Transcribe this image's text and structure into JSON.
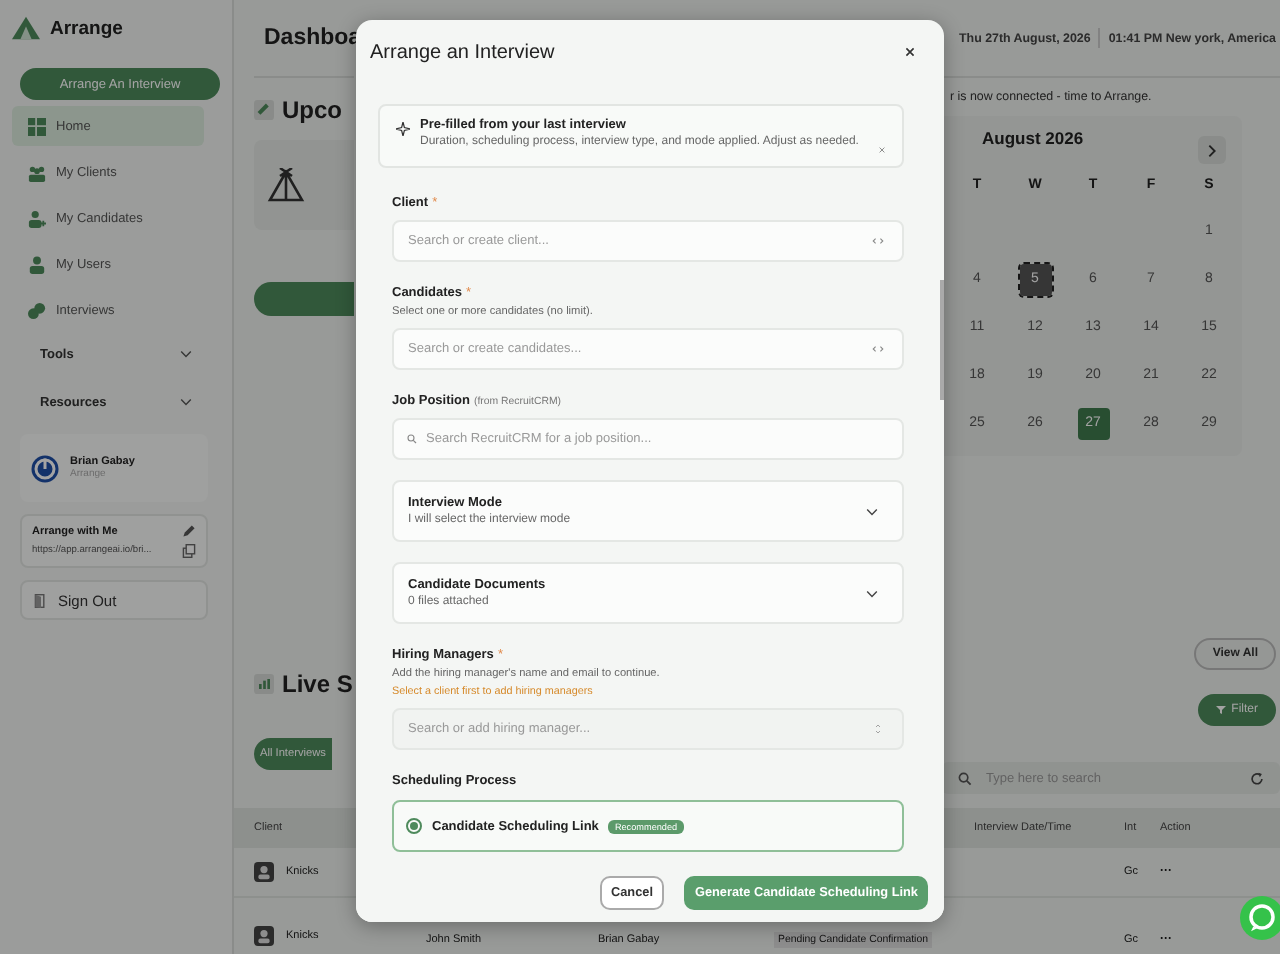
{
  "sidebar": {
    "brand": "Arrange",
    "cta": "Arrange An Interview",
    "items": [
      {
        "label": "Home",
        "selected": true
      },
      {
        "label": "My Clients",
        "selected": false
      },
      {
        "label": "My Candidates",
        "selected": false
      },
      {
        "label": "My Users",
        "selected": false
      },
      {
        "label": "Interviews",
        "selected": false
      }
    ],
    "sections": [
      {
        "label": "Tools",
        "expanded": false
      },
      {
        "label": "Resources",
        "expanded": false
      }
    ],
    "user": {
      "name": "Brian Gabay",
      "org": "Arrange"
    },
    "share": {
      "title": "Arrange with Me",
      "url": "https://app.arrangeai.io/bri..."
    },
    "sign_out": "Sign Out"
  },
  "header": {
    "title": "Dashboa",
    "date": "Thu 27th August, 2026",
    "time": "01:41 PM New york, America"
  },
  "upcoming": {
    "title": "Upco",
    "notice": "r is now connected - time to Arrange."
  },
  "calendar": {
    "month": "August 2026",
    "weekdays": [
      "T",
      "W",
      "T",
      "F",
      "S"
    ],
    "weeks": [
      [
        {
          "day": "1",
          "selected": false,
          "marked": false
        }
      ],
      [
        {
          "day": "4",
          "selected": false,
          "marked": false
        },
        {
          "day": "5",
          "selected": false,
          "marked": true
        },
        {
          "day": "6",
          "selected": false,
          "marked": false
        },
        {
          "day": "7",
          "selected": false,
          "marked": false
        },
        {
          "day": "8",
          "selected": false,
          "marked": false
        }
      ],
      [
        {
          "day": "11",
          "selected": false,
          "marked": false
        },
        {
          "day": "12",
          "selected": false,
          "marked": false
        },
        {
          "day": "13",
          "selected": false,
          "marked": false
        },
        {
          "day": "14",
          "selected": false,
          "marked": false
        },
        {
          "day": "15",
          "selected": false,
          "marked": false
        }
      ],
      [
        {
          "day": "18",
          "selected": false,
          "marked": false
        },
        {
          "day": "19",
          "selected": false,
          "marked": false
        },
        {
          "day": "20",
          "selected": false,
          "marked": false
        },
        {
          "day": "21",
          "selected": false,
          "marked": false
        },
        {
          "day": "22",
          "selected": false,
          "marked": false
        }
      ],
      [
        {
          "day": "25",
          "selected": false,
          "marked": false
        },
        {
          "day": "26",
          "selected": false,
          "marked": false
        },
        {
          "day": "27",
          "selected": true,
          "marked": false
        },
        {
          "day": "28",
          "selected": false,
          "marked": false
        },
        {
          "day": "29",
          "selected": false,
          "marked": false
        }
      ]
    ]
  },
  "live": {
    "title": "Live S",
    "view_all": "View All",
    "filter": "Filter",
    "tabs": [
      {
        "label": "All Interviews",
        "selected": true
      }
    ],
    "search": {
      "placeholder": "Type here to search"
    },
    "table": {
      "columns": [
        "Client",
        "Interview Date/Time",
        "Int",
        "Action"
      ],
      "rows": [
        {
          "client": "Knicks",
          "int": "Gc",
          "action": "···"
        },
        {
          "client": "Knicks",
          "candidate": "John Smith",
          "owner": "Brian Gabay",
          "status": "Pending Candidate Confirmation",
          "int": "Gc",
          "action": "···"
        }
      ]
    }
  },
  "modal": {
    "title": "Arrange an Interview",
    "banner": {
      "title": "Pre-filled from your last interview",
      "text": "Duration, scheduling process, interview type, and mode applied. Adjust as needed."
    },
    "fields": [
      {
        "kind": "select",
        "label": "Client",
        "required_mark": "*",
        "placeholder": "Search or create client...",
        "disabled": false
      },
      {
        "kind": "select",
        "label": "Candidates",
        "required_mark": "*",
        "hint": "Select one or more candidates (no limit).",
        "placeholder": "Search or create candidates...",
        "disabled": false
      },
      {
        "kind": "search",
        "label": "Job Position",
        "note": "(from RecruitCRM)",
        "placeholder": "Search RecruitCRM for a job position..."
      },
      {
        "kind": "accordion",
        "label": "Interview Mode",
        "value": "I will select the interview mode",
        "expanded": false
      },
      {
        "kind": "accordion",
        "label": "Candidate Documents",
        "value": "0 files attached",
        "expanded": false
      },
      {
        "kind": "select",
        "label": "Hiring Managers",
        "required_mark": "*",
        "hint": "Add the hiring manager's name and email to continue.",
        "warning": "Select a client first to add hiring managers",
        "placeholder": "Search or add hiring manager...",
        "disabled": true
      },
      {
        "kind": "radio-group",
        "label": "Scheduling Process",
        "options": [
          {
            "label": "Candidate Scheduling Link",
            "badge": "Recommended",
            "selected": true
          }
        ]
      }
    ],
    "buttons": [
      {
        "label": "Cancel",
        "kind": "secondary"
      },
      {
        "label": "Generate Candidate Scheduling Link",
        "kind": "primary"
      }
    ]
  }
}
